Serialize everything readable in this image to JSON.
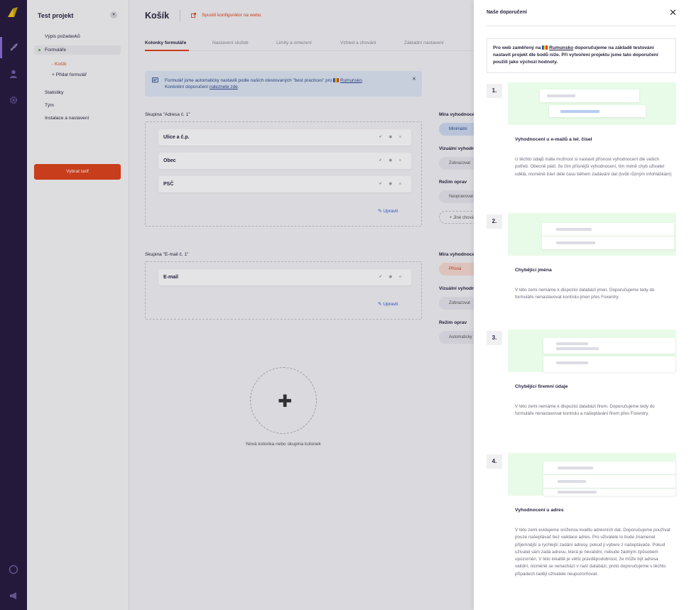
{
  "project": {
    "name": "Test projekt",
    "chevron": "▾"
  },
  "nav": {
    "items": [
      {
        "label": "Výpis požadavků"
      },
      {
        "label": "Formuláře"
      },
      {
        "label": "Statistiky"
      },
      {
        "label": "Tým"
      },
      {
        "label": "Instalace a nastavení"
      }
    ],
    "sub": [
      {
        "label": "- Košík"
      },
      {
        "label": "+ Přidat formulář"
      }
    ],
    "tarif_button": "Vybrat tarif"
  },
  "header": {
    "title": "Košík",
    "launch_label": "Spustit konfigurátor na webu"
  },
  "tabs": [
    {
      "label": "Kolonky formuláře"
    },
    {
      "label": "Nastavení služeb"
    },
    {
      "label": "Limity a omezení"
    },
    {
      "label": "Vzhled a chování"
    },
    {
      "label": "Základní nastavení"
    }
  ],
  "info": {
    "text_a": "Formulář jsme automaticky nastavili podle našich otestovaných \"best practices\" pro",
    "country": "Rumunsko",
    "text_b": "Konkrétní doporučení",
    "link": "naleznete zde"
  },
  "groups": [
    {
      "title": "Skupina \"Adresa č. 1\"",
      "fields": [
        "Ulice a č.p.",
        "Obec",
        "PSČ"
      ],
      "edit": "Upravit",
      "side": {
        "label1": "Míra vyhodnoce",
        "pill1": "Minimální",
        "label2": "Vizuální vyhodn",
        "pill2": "Zobrazovat",
        "label3": "Režim oprav",
        "pill3": "Neopravovat",
        "pill4": "+ Jiné chován"
      }
    },
    {
      "title": "Skupina \"E-mail č. 1\"",
      "fields": [
        "E-mail"
      ],
      "edit": "Upravit",
      "side": {
        "label1": "Míra vyhodnoce",
        "pill1": "Přísná",
        "label2": "Vizuální vyhodn",
        "pill2": "Zobrazovat",
        "label3": "Režim oprav",
        "pill3": "Automaticky"
      }
    }
  ],
  "field_icons": "✔ ◉ ≡",
  "add_new": {
    "label": "Nová kolonka nebo skupina kolonek"
  },
  "drawer": {
    "title": "Naše doporučení",
    "intro_a": "Pro web zaměřený na",
    "intro_country": "Rumunsko",
    "intro_b": "doporučujeme na základě testování nastavit projekt dle bodů níže. Při vytvoření projektu jsme tato doporučení použili jako výchozí hodnoty.",
    "steps": [
      {
        "num": "1.",
        "title": "Vyhodnocení u e-mailů a tel. čísel",
        "desc": "U těchto údajů máte možnost si nastavit přísnost vyhodnocení dle vašich potřeb. Obecně platí, že čím přísnější vyhodnocení, tím méně chyb uživatel udělá, nicméně tráví déle času během zadávání dat (kvůli různým infohláškám)"
      },
      {
        "num": "2.",
        "title": "Chybějící jména",
        "desc": "V této zemi nemáme k dispozici databázi jmen. Doporučujeme tedy do formuláře nenastavovat kontrolu jmen přes Foxentry."
      },
      {
        "num": "3.",
        "title": "Chybějící firemní údaje",
        "desc": "V této zemi nemáme k dispozici databázi firem. Doporučujeme tedy do formuláře nenastavovat kontrolu a našeptávání firem přes Foxentry."
      },
      {
        "num": "4.",
        "title": "Vyhodnocení u adres",
        "desc": "V této zemi evidujeme sníženou kvalitu adresních dat. Doporučujeme používat pouze našeptávač bez validace adres. Pro uživatele to bude znamenat příjemnější a rychlejší zadání adresy, pokud ji vybere z našeptávače. Pokud uživatel sám zadá adresu, která je nevalidní, nebude žádným způsobem upozorněn. V této lokalitě je větší pravděpodobnost, že může být adresa validní, nicméně se nenachází v naší databázi, proto doporučujeme v těchto případech raději uživatele neupozorňovat."
      }
    ]
  },
  "colors": {
    "accent": "#e0431a",
    "rail": "#251a3d",
    "link": "#2a5ad8",
    "success_bg": "#e8fbe8"
  }
}
